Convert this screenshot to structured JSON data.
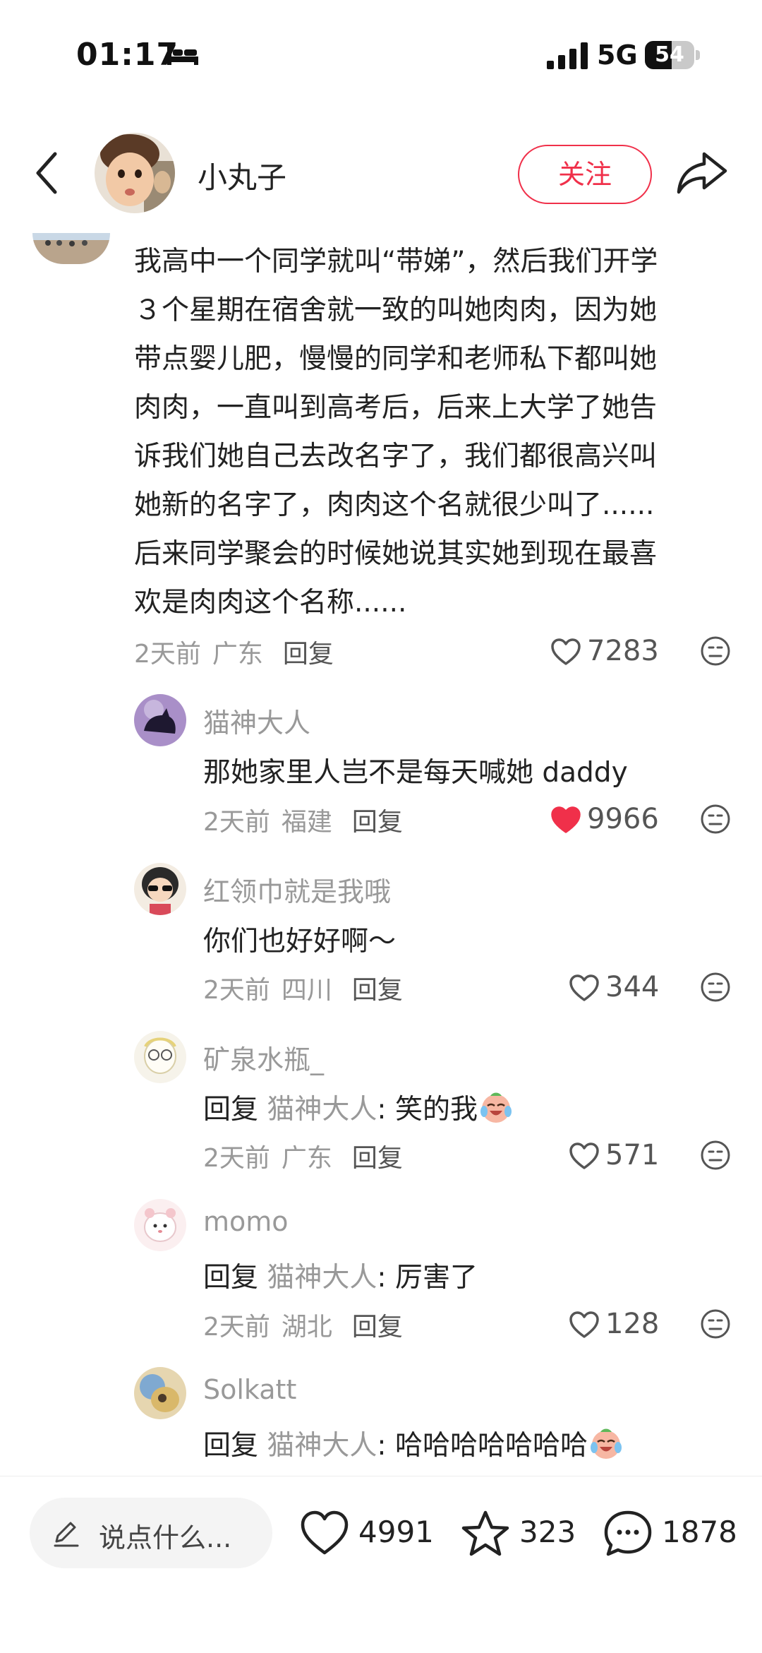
{
  "status_bar": {
    "time": "01:17",
    "network": "5G",
    "battery": "54",
    "battery_level": 0.54
  },
  "header": {
    "username": "小丸子",
    "follow_label": "关注"
  },
  "main_comment": {
    "lines": [
      "我高中一个同学就叫“带娣”，然后我们开学",
      "３个星期在宿舍就一致的叫她肉肉，因为她",
      "带点婴儿肥，慢慢的同学和老师私下都叫她",
      "肉肉，一直叫到高考后，后来上大学了她告",
      "诉我们她自己去改名字了，我们都很高兴叫",
      "她新的名字了，肉肉这个名就很少叫了......",
      "后来同学聚会的时候她说其实她到现在最喜",
      "欢是肉肉这个名称......"
    ],
    "time": "2天前",
    "location": "广东",
    "reply_label": "回复",
    "likes": "7283"
  },
  "replies": [
    {
      "name": "猫神大人",
      "prefix": "",
      "target": "",
      "text": "那她家里人岂不是每天喊她 daddy",
      "time": "2天前",
      "location": "福建",
      "reply_label": "回复",
      "likes": "9966",
      "liked": true
    },
    {
      "name": "红领巾就是我哦",
      "prefix": "",
      "target": "",
      "text": "你们也好好啊～",
      "time": "2天前",
      "location": "四川",
      "reply_label": "回复",
      "likes": "344",
      "liked": false
    },
    {
      "name": "矿泉水瓶_",
      "prefix": "回复 ",
      "target": "猫神大人",
      "text": ": 笑的我",
      "emoji": "crying-laughing-emoji",
      "time": "2天前",
      "location": "广东",
      "reply_label": "回复",
      "likes": "571",
      "liked": false
    },
    {
      "name": "momo",
      "prefix": "回复 ",
      "target": "猫神大人",
      "text": ": 厉害了",
      "time": "2天前",
      "location": "湖北",
      "reply_label": "回复",
      "likes": "128",
      "liked": false
    },
    {
      "name": "Solkatt",
      "prefix": "回复 ",
      "target": "猫神大人",
      "text": ": 哈哈哈哈哈哈哈",
      "emoji": "crying-laughing-emoji",
      "time": "",
      "location": "",
      "reply_label": "",
      "likes": "",
      "liked": false
    }
  ],
  "bottom_bar": {
    "input_placeholder": "说点什么...",
    "likes": "4991",
    "favorites": "323",
    "comments": "1878"
  },
  "colors": {
    "accent": "#f0304a",
    "muted": "#999999",
    "text": "#222222",
    "liked": "#f0304a"
  }
}
